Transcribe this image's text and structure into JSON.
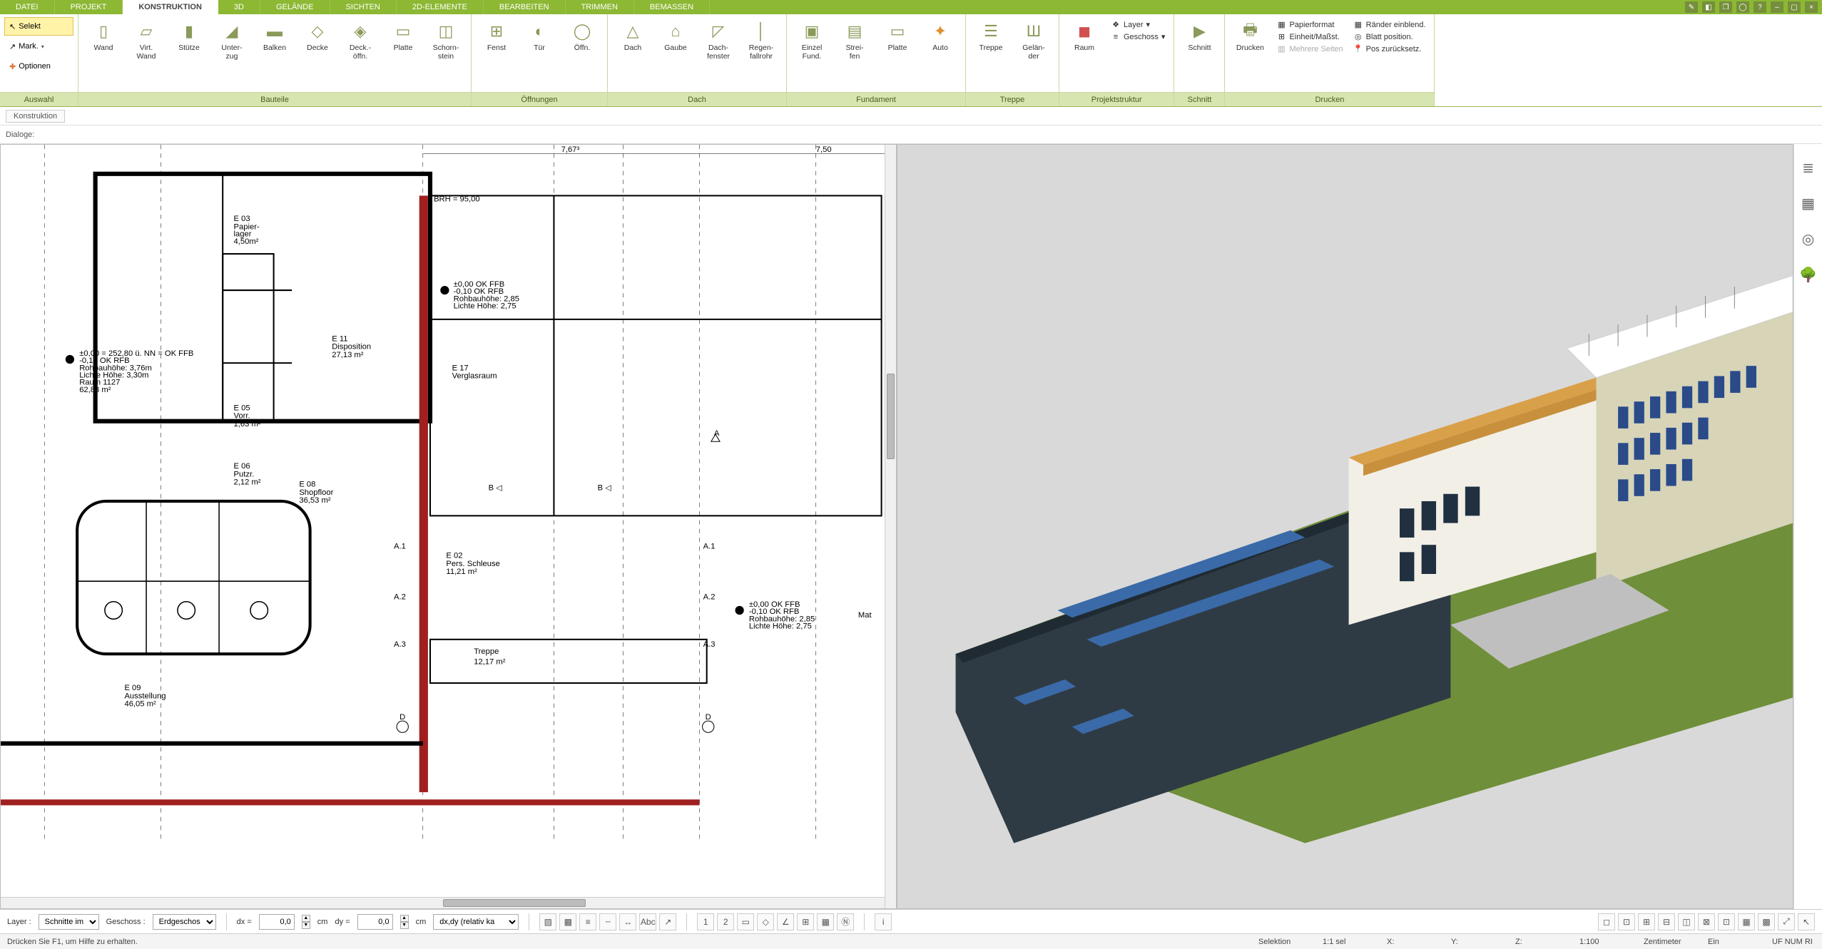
{
  "menu": {
    "tabs": [
      "DATEI",
      "PROJEKT",
      "KONSTRUKTION",
      "3D",
      "GELÄNDE",
      "SICHTEN",
      "2D-ELEMENTE",
      "BEARBEITEN",
      "TRIMMEN",
      "BEMASSEN"
    ],
    "active": "KONSTRUKTION"
  },
  "selection": {
    "selekt": "Selekt",
    "mark": "Mark.",
    "optionen": "Optionen",
    "caption": "Auswahl"
  },
  "ribbon": {
    "groups": {
      "bauteile": {
        "caption": "Bauteile",
        "tools": [
          "Wand",
          "Virt.\nWand",
          "Stütze",
          "Unter-\nzug",
          "Balken",
          "Decke",
          "Deck.-\nöffn.",
          "Platte",
          "Schorn-\nstein"
        ]
      },
      "oeffnungen": {
        "caption": "Öffnungen",
        "tools": [
          "Fenst",
          "Tür",
          "Öffn."
        ]
      },
      "dach": {
        "caption": "Dach",
        "tools": [
          "Dach",
          "Gaube",
          "Dach-\nfenster",
          "Regen-\nfallrohr"
        ]
      },
      "fundament": {
        "caption": "Fundament",
        "tools": [
          "Einzel\nFund.",
          "Strei-\nfen",
          "Platte",
          "Auto"
        ]
      },
      "treppe": {
        "caption": "Treppe",
        "tools": [
          "Treppe",
          "Gelän-\nder"
        ]
      },
      "projektstruktur": {
        "caption": "Projektstruktur",
        "tools": [
          "Raum"
        ],
        "rows": [
          "Layer",
          "Geschoss"
        ]
      },
      "schnitt": {
        "caption": "Schnitt",
        "tools": [
          "Schnitt"
        ]
      },
      "drucken": {
        "caption": "Drucken",
        "tools": [
          "Drucken"
        ],
        "rows_left": [
          "Papierformat",
          "Einheit/Maßst.",
          "Mehrere Seiten"
        ],
        "rows_right": [
          "Ränder einblend.",
          "Blatt position.",
          "Pos zurücksetz."
        ]
      }
    }
  },
  "subheader": {
    "konstruktion": "Konstruktion",
    "dialoge": "Dialoge:"
  },
  "plan": {
    "dims_top": [
      "7,67³",
      "7,50"
    ],
    "markers": [
      "A",
      "A.1",
      "A.2",
      "A.3",
      "B",
      "D"
    ],
    "rooms": [
      {
        "id": "E03",
        "name": "Papier-\nlager",
        "area": "4,50m²"
      },
      {
        "id": "E05",
        "name": "Vorr.",
        "area": "1,63 m²"
      },
      {
        "id": "E06",
        "name": "Putzr.",
        "area": "2,12 m²"
      },
      {
        "id": "E11",
        "name": "Disposition",
        "area": "27,13 m²"
      },
      {
        "id": "E17",
        "name": "Verglasraum",
        "area": ""
      },
      {
        "id": "E08",
        "name": "Shopfloor",
        "area": "36,53 m²"
      },
      {
        "id": "E02",
        "name": "Pers. Schleuse",
        "area": "11,21 m²"
      },
      {
        "id": "E09",
        "name": "Ausstellung",
        "area": "46,05 m²"
      }
    ],
    "elev1": {
      "l1": "±0,00 = 252,80 ü. NN = OK FFB",
      "l2": "-0,15 OK RFB",
      "l3": "Rohbauhöhe: 3,76m",
      "l4": "Lichte Höhe: 3,30m",
      "l5": "Raum 1127",
      "l6": "62,88 m²"
    },
    "elev2": {
      "l1": "±0,00  OK FFB",
      "l2": "-0,10 OK RFB",
      "l3": "Rohbauhöhe: 2,85",
      "l4": "Lichte Höhe: 2,75"
    },
    "elev3": {
      "l1": "±0,00  OK FFB",
      "l2": "-0,10 OK RFB",
      "l3": "Rohbauhöhe: 2,85",
      "l4": "Lichte Höhe: 2,75"
    },
    "brh": "BRH = 95,00",
    "treppe": "Treppe",
    "treppe_area": "12,17 m²",
    "mat": "Mat"
  },
  "bottom": {
    "layer_lbl": "Layer :",
    "layer_val": "Schnitte im",
    "geschoss_lbl": "Geschoss :",
    "geschoss_val": "Erdgeschos",
    "dx_lbl": "dx =",
    "dx_val": "0,0",
    "dx_unit": "cm",
    "dy_lbl": "dy =",
    "dy_val": "0,0",
    "dy_unit": "cm",
    "mode": "dx,dy (relativ ka"
  },
  "status": {
    "help": "Drücken Sie F1, um Hilfe zu erhalten.",
    "sel": "Selektion",
    "scale_sel": "1:1 sel",
    "x": "X:",
    "y": "Y:",
    "z": "Z:",
    "scale": "1:100",
    "unit": "Zentimeter",
    "ein": "Ein",
    "flags": "UF  NUM  RI"
  },
  "icons": {
    "layers": "≣",
    "chair": "▦",
    "target": "◎",
    "tree": "🌳",
    "pencil": "✎",
    "cube": "◧",
    "stack": "❐",
    "circle": "◯",
    "help": "?"
  }
}
